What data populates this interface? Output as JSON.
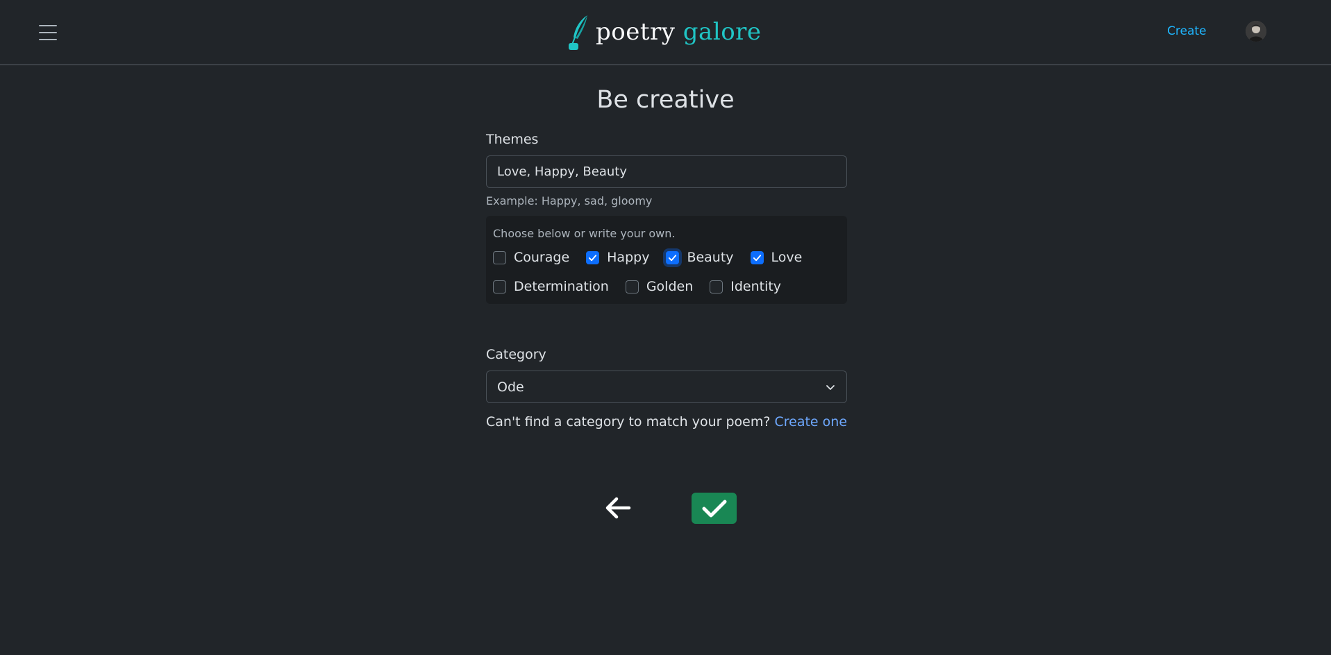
{
  "navbar": {
    "brand_word1": "poetry",
    "brand_word2": "galore",
    "create_link": "Create",
    "icons": {
      "menu": "hamburger-menu-icon",
      "logo": "quill-ink-icon",
      "avatar": "user-avatar"
    },
    "colors": {
      "brand_accent": "#20c5c5",
      "link": "#1fb6ff"
    }
  },
  "main": {
    "title": "Be creative",
    "themes": {
      "label": "Themes",
      "value": "Love, Happy, Beauty",
      "helper": "Example: Happy, sad, gloomy",
      "choice_hint": "Choose below or write your own.",
      "options": [
        {
          "label": "Courage",
          "checked": false
        },
        {
          "label": "Happy",
          "checked": true
        },
        {
          "label": "Beauty",
          "checked": true,
          "focused": true
        },
        {
          "label": "Love",
          "checked": true
        },
        {
          "label": "Determination",
          "checked": false
        },
        {
          "label": "Golden",
          "checked": false
        },
        {
          "label": "Identity",
          "checked": false
        }
      ]
    },
    "category": {
      "label": "Category",
      "selected": "Ode",
      "cant_find_text": "Can't find a category to match your poem?",
      "create_one_link": "Create one"
    },
    "actions": {
      "back_icon": "arrow-left-icon",
      "submit_icon": "check-icon",
      "submit_color": "#198754"
    }
  }
}
